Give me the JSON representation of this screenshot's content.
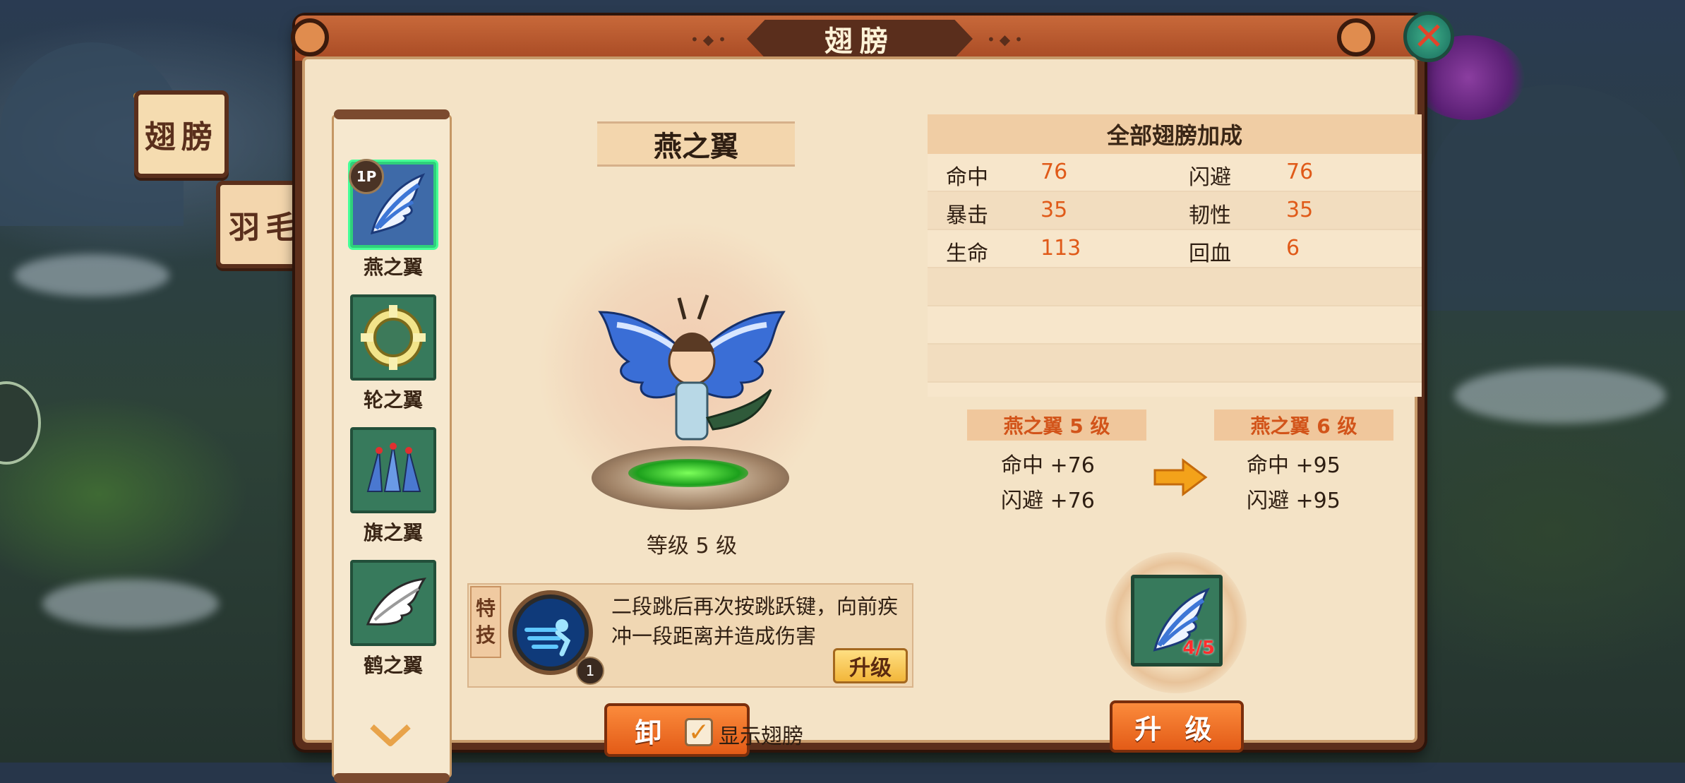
{
  "window": {
    "title": "翅膀",
    "close_icon": "close-x-icon"
  },
  "side_tabs": [
    {
      "label": "翅膀",
      "active": true
    },
    {
      "label": "羽毛",
      "active": false
    }
  ],
  "wing_list": {
    "player_badge": "1P",
    "items": [
      {
        "name": "燕之翼",
        "icon": "swallow-wing-icon",
        "selected": true
      },
      {
        "name": "轮之翼",
        "icon": "wheel-wing-icon",
        "selected": false
      },
      {
        "name": "旗之翼",
        "icon": "flag-wing-icon",
        "selected": false
      },
      {
        "name": "鹤之翼",
        "icon": "crane-wing-icon",
        "selected": false
      }
    ],
    "more_icon": "chevron-down-icon"
  },
  "selected_wing": {
    "name": "燕之翼",
    "level_text": "等级 5 级",
    "skill": {
      "tag": [
        "特",
        "技"
      ],
      "level": "1",
      "description": "二段跳后再次按跳跃键，向前疾冲一段距离并造成伤害",
      "upgrade_label": "升级"
    },
    "unequip_label": "卸 下",
    "show_wings_label": "显示翅膀",
    "show_wings_checked": true
  },
  "bonus": {
    "title": "全部翅膀加成",
    "rows": [
      [
        {
          "label": "命中",
          "value": "76"
        },
        {
          "label": "闪避",
          "value": "76"
        }
      ],
      [
        {
          "label": "暴击",
          "value": "35"
        },
        {
          "label": "韧性",
          "value": "35"
        }
      ],
      [
        {
          "label": "生命",
          "value": "113"
        },
        {
          "label": "回血",
          "value": "6"
        }
      ]
    ]
  },
  "level_compare": {
    "current": {
      "title": "燕之翼 5 级",
      "stats": [
        "命中 +76",
        "闪避 +76"
      ]
    },
    "next": {
      "title": "燕之翼 6 级",
      "stats": [
        "命中 +95",
        "闪避 +95"
      ]
    }
  },
  "upgrade": {
    "material_count": "4/5",
    "button_label": "升 级"
  },
  "colors": {
    "frame": "#5b2e1b",
    "panel": "#f4e3c6",
    "accent_orange": "#e05a19",
    "selected_border": "#2fd07a"
  }
}
